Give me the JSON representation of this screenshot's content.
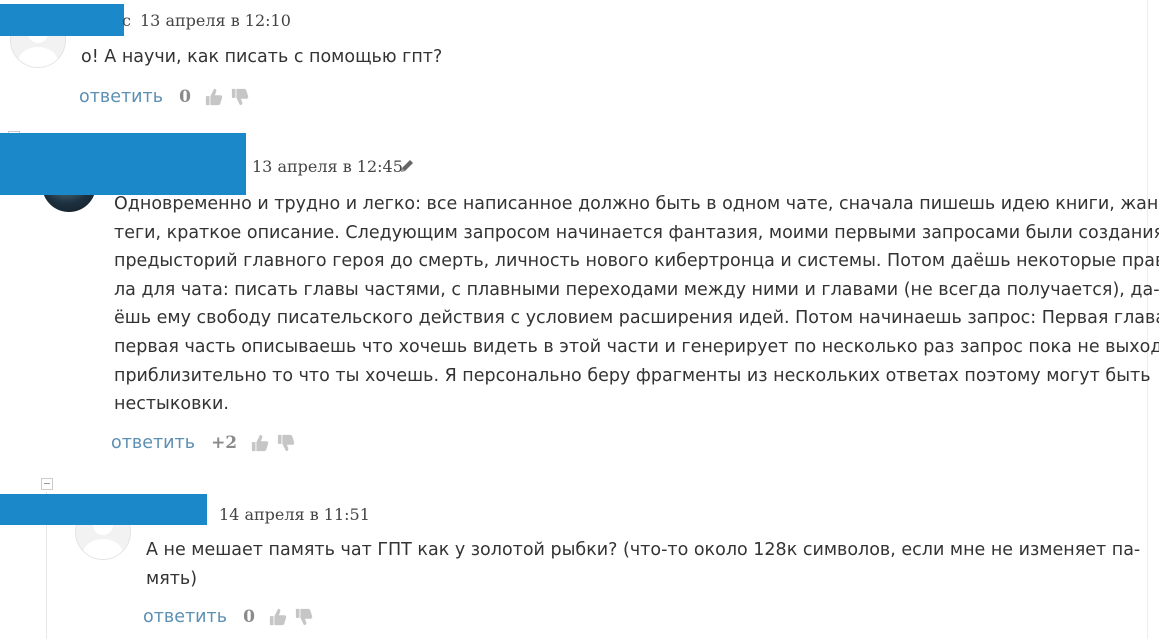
{
  "comments": [
    {
      "author_tail": "с",
      "date": "13 апреля в 12:10",
      "text": "о! А научи, как писать с помощью гпт?",
      "reply_label": "ответить",
      "score": "0",
      "avatar_icon": "default-user-avatar"
    },
    {
      "date": "13 апреля в 12:45",
      "edited_icon": "pencil-icon",
      "text_lines": [
        "Одновременно и трудно и легко: все написанное должно быть в одном чате, сначала пишешь идею книги, жанр,",
        "теги, краткое описание. Следующим запросом начинается фантазия, моими первыми запросами были создания",
        "предысторий главного героя до смерть, личность нового кибертронца и системы. Потом даёшь некоторые прави-",
        "ла для чата: писать главы частями, с плавными переходами между ними и главами (не всегда получается), да-",
        "ёшь ему свободу писательского действия с условием расширения идей. Потом начинаешь запрос: Первая глава,",
        "первая часть описываешь что хочешь видеть в этой части и генерирует по несколько раз запрос пока не выходит",
        "приблизительно то что ты хочешь. Я персонально беру фрагменты из нескольких ответах поэтому могут быть",
        "нестыковки."
      ],
      "reply_label": "ответить",
      "score": "+2",
      "avatar_icon": "user-photo-avatar"
    },
    {
      "date": "14 апреля в 11:51",
      "text_lines": [
        "А не мешает память чат ГПТ как у золотой рыбки? (что-то около 128к символов, если мне не изменяет па-",
        "мять)"
      ],
      "reply_label": "ответить",
      "score": "0",
      "avatar_icon": "default-user-avatar"
    }
  ],
  "colors": {
    "redaction": "#1a88c9",
    "reply_link": "#5c8fb3",
    "score": "#8a8a8a",
    "thumb": "#c6c6c6"
  }
}
